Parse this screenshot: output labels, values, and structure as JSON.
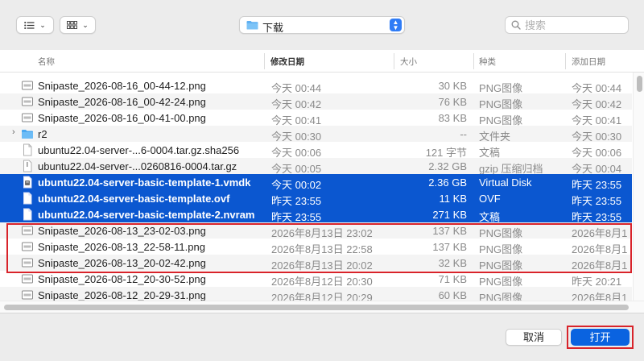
{
  "toolbar": {
    "location": "下载",
    "search_placeholder": "搜索"
  },
  "columns": {
    "name": "名称",
    "date_modified": "修改日期",
    "size": "大小",
    "kind": "种类",
    "date_added": "添加日期"
  },
  "files": [
    {
      "name": "Snipaste_2026-08-16_00-44-12.png",
      "modified": "今天 00:44",
      "size": "30 KB",
      "kind": "PNG图像",
      "added": "今天 00:44",
      "icon": "image-file-icon",
      "selected": false
    },
    {
      "name": "Snipaste_2026-08-16_00-42-24.png",
      "modified": "今天 00:42",
      "size": "76 KB",
      "kind": "PNG图像",
      "added": "今天 00:42",
      "icon": "image-file-icon",
      "selected": false
    },
    {
      "name": "Snipaste_2026-08-16_00-41-00.png",
      "modified": "今天 00:41",
      "size": "83 KB",
      "kind": "PNG图像",
      "added": "今天 00:41",
      "icon": "image-file-icon",
      "selected": false
    },
    {
      "name": "r2",
      "modified": "今天 00:30",
      "size": "--",
      "kind": "文件夹",
      "added": "今天 00:30",
      "icon": "folder-icon",
      "selected": false,
      "expandable": true
    },
    {
      "name": "ubuntu22.04-server-...6-0004.tar.gz.sha256",
      "modified": "今天 00:06",
      "size": "121 字节",
      "kind": "文稿",
      "added": "今天 00:06",
      "icon": "document-icon",
      "selected": false
    },
    {
      "name": "ubuntu22.04-server-...0260816-0004.tar.gz",
      "modified": "今天 00:05",
      "size": "2.32 GB",
      "kind": "gzip 压缩归档",
      "added": "今天 00:04",
      "icon": "archive-icon",
      "selected": false
    },
    {
      "name": "ubuntu22.04-server-basic-template-1.vmdk",
      "modified": "今天 00:02",
      "size": "2.36 GB",
      "kind": "Virtual Disk",
      "added": "昨天 23:55",
      "icon": "disk-file-icon",
      "selected": true
    },
    {
      "name": "ubuntu22.04-server-basic-template.ovf",
      "modified": "昨天 23:55",
      "size": "11 KB",
      "kind": "OVF",
      "added": "昨天 23:55",
      "icon": "document-icon",
      "selected": true
    },
    {
      "name": "ubuntu22.04-server-basic-template-2.nvram",
      "modified": "昨天 23:55",
      "size": "271 KB",
      "kind": "文稿",
      "added": "昨天 23:55",
      "icon": "document-icon",
      "selected": true
    },
    {
      "name": "Snipaste_2026-08-13_23-02-03.png",
      "modified": "2026年8月13日 23:02",
      "size": "137 KB",
      "kind": "PNG图像",
      "added": "2026年8月1",
      "icon": "image-file-icon",
      "selected": false
    },
    {
      "name": "Snipaste_2026-08-13_22-58-11.png",
      "modified": "2026年8月13日 22:58",
      "size": "137 KB",
      "kind": "PNG图像",
      "added": "2026年8月1",
      "icon": "image-file-icon",
      "selected": false
    },
    {
      "name": "Snipaste_2026-08-13_20-02-42.png",
      "modified": "2026年8月13日 20:02",
      "size": "32 KB",
      "kind": "PNG图像",
      "added": "2026年8月1",
      "icon": "image-file-icon",
      "selected": false
    },
    {
      "name": "Snipaste_2026-08-12_20-30-52.png",
      "modified": "2026年8月12日 20:30",
      "size": "71 KB",
      "kind": "PNG图像",
      "added": "昨天 20:21",
      "icon": "image-file-icon",
      "selected": false
    },
    {
      "name": "Snipaste_2026-08-12_20-29-31.png",
      "modified": "2026年8月12日 20:29",
      "size": "60 KB",
      "kind": "PNG图像",
      "added": "2026年8月1",
      "icon": "image-file-icon",
      "selected": false
    }
  ],
  "footer": {
    "cancel_label": "取消",
    "open_label": "打开"
  },
  "colors": {
    "selection": "#0b57d0",
    "accent": "#0a63e0",
    "highlight_box": "#d8232a"
  }
}
